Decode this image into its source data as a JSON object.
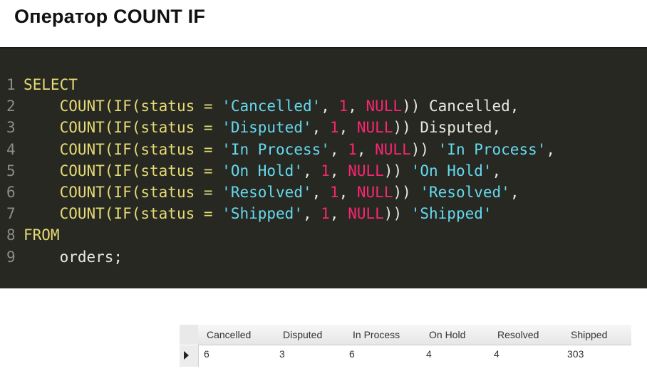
{
  "slide": {
    "title": "Оператор COUNT IF"
  },
  "code": {
    "lines": [
      {
        "n": "1",
        "tokens": [
          {
            "t": "kw",
            "v": "SELECT"
          }
        ]
      },
      {
        "n": "2",
        "tokens": [
          {
            "t": "plain",
            "v": "    "
          },
          {
            "t": "fn",
            "v": "COUNT(IF(status ="
          },
          {
            "t": "plain",
            "v": " "
          },
          {
            "t": "str",
            "v": "'Cancelled'"
          },
          {
            "t": "plain",
            "v": ", "
          },
          {
            "t": "num",
            "v": "1"
          },
          {
            "t": "plain",
            "v": ", "
          },
          {
            "t": "nul",
            "v": "NULL"
          },
          {
            "t": "plain",
            "v": ")) Cancelled,"
          }
        ]
      },
      {
        "n": "3",
        "tokens": [
          {
            "t": "plain",
            "v": "    "
          },
          {
            "t": "fn",
            "v": "COUNT(IF(status ="
          },
          {
            "t": "plain",
            "v": " "
          },
          {
            "t": "str",
            "v": "'Disputed'"
          },
          {
            "t": "plain",
            "v": ", "
          },
          {
            "t": "num",
            "v": "1"
          },
          {
            "t": "plain",
            "v": ", "
          },
          {
            "t": "nul",
            "v": "NULL"
          },
          {
            "t": "plain",
            "v": ")) Disputed,"
          }
        ]
      },
      {
        "n": "4",
        "tokens": [
          {
            "t": "plain",
            "v": "    "
          },
          {
            "t": "fn",
            "v": "COUNT(IF(status ="
          },
          {
            "t": "plain",
            "v": " "
          },
          {
            "t": "str",
            "v": "'In Process'"
          },
          {
            "t": "plain",
            "v": ", "
          },
          {
            "t": "num",
            "v": "1"
          },
          {
            "t": "plain",
            "v": ", "
          },
          {
            "t": "nul",
            "v": "NULL"
          },
          {
            "t": "plain",
            "v": ")) "
          },
          {
            "t": "str",
            "v": "'In Process'"
          },
          {
            "t": "plain",
            "v": ","
          }
        ]
      },
      {
        "n": "5",
        "tokens": [
          {
            "t": "plain",
            "v": "    "
          },
          {
            "t": "fn",
            "v": "COUNT(IF(status ="
          },
          {
            "t": "plain",
            "v": " "
          },
          {
            "t": "str",
            "v": "'On Hold'"
          },
          {
            "t": "plain",
            "v": ", "
          },
          {
            "t": "num",
            "v": "1"
          },
          {
            "t": "plain",
            "v": ", "
          },
          {
            "t": "nul",
            "v": "NULL"
          },
          {
            "t": "plain",
            "v": ")) "
          },
          {
            "t": "str",
            "v": "'On Hold'"
          },
          {
            "t": "plain",
            "v": ","
          }
        ]
      },
      {
        "n": "6",
        "tokens": [
          {
            "t": "plain",
            "v": "    "
          },
          {
            "t": "fn",
            "v": "COUNT(IF(status ="
          },
          {
            "t": "plain",
            "v": " "
          },
          {
            "t": "str",
            "v": "'Resolved'"
          },
          {
            "t": "plain",
            "v": ", "
          },
          {
            "t": "num",
            "v": "1"
          },
          {
            "t": "plain",
            "v": ", "
          },
          {
            "t": "nul",
            "v": "NULL"
          },
          {
            "t": "plain",
            "v": ")) "
          },
          {
            "t": "str",
            "v": "'Resolved'"
          },
          {
            "t": "plain",
            "v": ","
          }
        ]
      },
      {
        "n": "7",
        "tokens": [
          {
            "t": "plain",
            "v": "    "
          },
          {
            "t": "fn",
            "v": "COUNT(IF(status ="
          },
          {
            "t": "plain",
            "v": " "
          },
          {
            "t": "str",
            "v": "'Shipped'"
          },
          {
            "t": "plain",
            "v": ", "
          },
          {
            "t": "num",
            "v": "1"
          },
          {
            "t": "plain",
            "v": ", "
          },
          {
            "t": "nul",
            "v": "NULL"
          },
          {
            "t": "plain",
            "v": ")) "
          },
          {
            "t": "str",
            "v": "'Shipped'"
          }
        ]
      },
      {
        "n": "8",
        "tokens": [
          {
            "t": "kw",
            "v": "FROM"
          }
        ]
      },
      {
        "n": "9",
        "tokens": [
          {
            "t": "plain",
            "v": "    orders;"
          }
        ]
      }
    ]
  },
  "result_grid": {
    "columns": [
      "Cancelled",
      "Disputed",
      "In Process",
      "On Hold",
      "Resolved",
      "Shipped"
    ],
    "rows": [
      [
        "6",
        "3",
        "6",
        "4",
        "4",
        "303"
      ]
    ]
  },
  "colors": {
    "editor_bg": "#272822",
    "keyword": "#e6db74",
    "string": "#66d9ef",
    "number": "#f92672",
    "text": "#e8e8e2",
    "line_number": "#8d8d86"
  }
}
